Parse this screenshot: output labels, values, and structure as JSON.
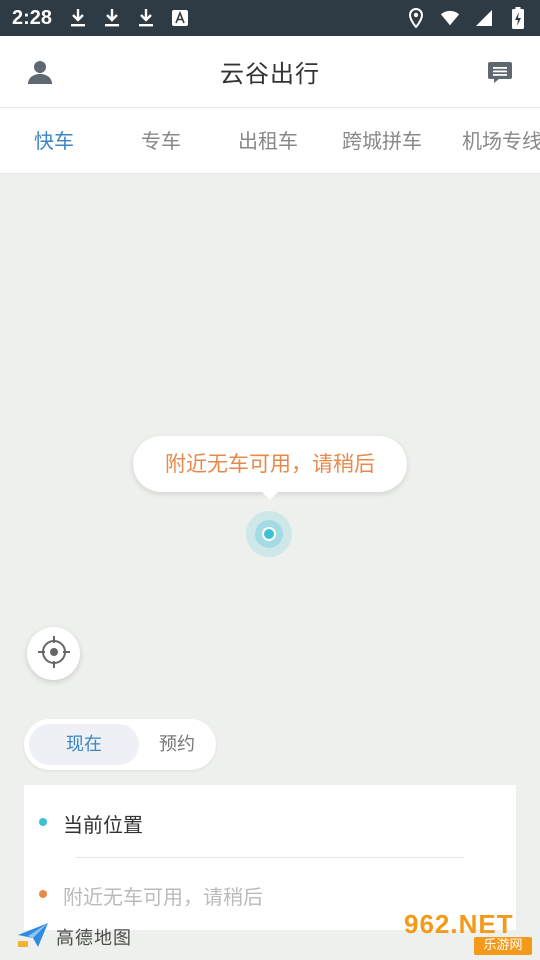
{
  "status_bar": {
    "time": "2:28",
    "left_icons": [
      "download-icon",
      "download-icon",
      "download-icon",
      "font-icon"
    ],
    "right_icons": [
      "location-pin-icon",
      "wifi-icon",
      "signal-icon",
      "battery-charging-icon"
    ]
  },
  "header": {
    "title": "云谷出行",
    "left_icon": "user-icon",
    "right_icon": "message-icon"
  },
  "tabs": [
    {
      "label": "快车",
      "active": true
    },
    {
      "label": "专车",
      "active": false
    },
    {
      "label": "出租车",
      "active": false
    },
    {
      "label": "跨城拼车",
      "active": false
    },
    {
      "label": "机场专线",
      "active": false
    }
  ],
  "map": {
    "bubble_text": "附近无车可用，请稍后",
    "marker_icon": "current-location-icon",
    "locate_icon": "crosshair-icon"
  },
  "time_toggle": {
    "now": "现在",
    "reserve": "预约"
  },
  "address": {
    "origin": "当前位置",
    "destination_placeholder": "附近无车可用，请稍后"
  },
  "map_attribution": "高德地图",
  "watermark": {
    "main": "962.NET",
    "sub": "乐游网"
  },
  "colors": {
    "accent": "#3a86c6",
    "warning": "#e8894b",
    "marker": "#3cc0d6",
    "status_bar": "#2e3b44"
  }
}
